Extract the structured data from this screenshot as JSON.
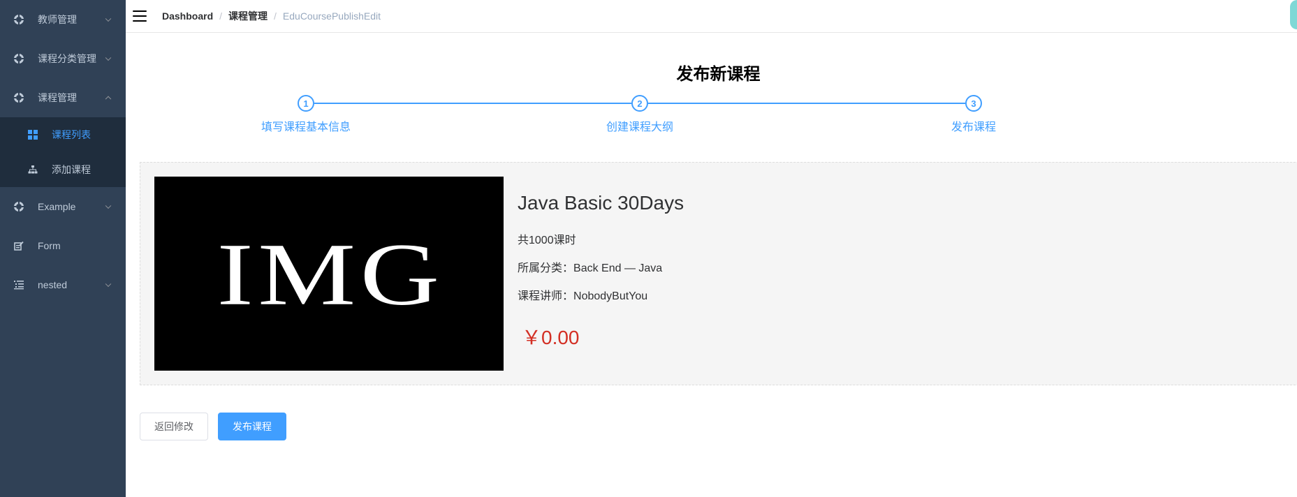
{
  "sidebar": {
    "menus": [
      {
        "label": "教师管理",
        "icon": "settings-icon",
        "expanded": false
      },
      {
        "label": "课程分类管理",
        "icon": "settings-icon",
        "expanded": false
      },
      {
        "label": "课程管理",
        "icon": "settings-icon",
        "expanded": true,
        "children": [
          {
            "label": "课程列表",
            "icon": "grid-icon",
            "active": true
          },
          {
            "label": "添加课程",
            "icon": "tree-icon",
            "active": false
          }
        ]
      },
      {
        "label": "Example",
        "icon": "settings-icon",
        "expanded": false
      },
      {
        "label": "Form",
        "icon": "form-icon"
      },
      {
        "label": "nested",
        "icon": "nested-list-icon",
        "expanded": false
      }
    ]
  },
  "navbar": {
    "breadcrumb": [
      "Dashboard",
      "课程管理",
      "EduCoursePublishEdit"
    ],
    "separator": "/"
  },
  "page": {
    "title": "发布新课程",
    "steps": [
      {
        "number": "1",
        "title": "填写课程基本信息"
      },
      {
        "number": "2",
        "title": "创建课程大纲"
      },
      {
        "number": "3",
        "title": "发布课程"
      }
    ]
  },
  "course": {
    "cover_text": "IMG",
    "title": "Java Basic 30Days",
    "lessons": "共1000课时",
    "category_label": "所属分类：",
    "category_value": "Back End — Java",
    "teacher_label": "课程讲师：",
    "teacher_value": "NobodyButYou",
    "price": "￥0.00"
  },
  "buttons": {
    "back": "返回修改",
    "publish": "发布课程"
  },
  "colors": {
    "sidebar_bg": "#304156",
    "submenu_bg": "#1f2d3d",
    "accent": "#409eff",
    "price": "#d32f24"
  }
}
